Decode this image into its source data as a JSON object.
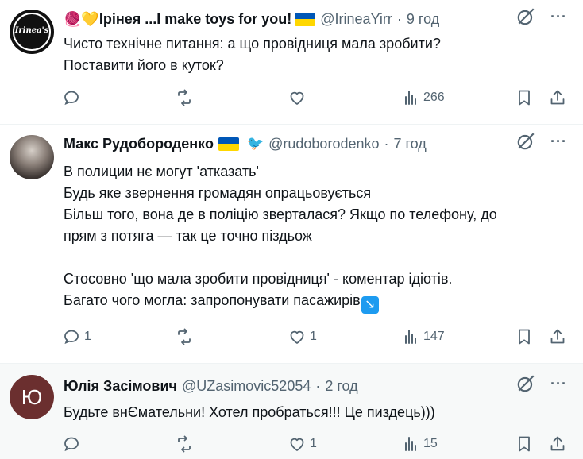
{
  "tweets": [
    {
      "name_prefix": "🧶💛",
      "name": "Ірінея ...I make toys for you!",
      "handle": "@IrineaYirr",
      "time": "9 год",
      "avatar_text": "Irinea's",
      "text": "Чисто технічне питання: а що провідниця мала зробити?\nПоставити його в куток?",
      "replies": "",
      "retweets": "",
      "likes": "",
      "views": "266"
    },
    {
      "name": "Макс Рудобороденко",
      "handle": "@rudoborodenko",
      "time": "7 год",
      "bird_emoji": "🐦",
      "text": "В полиции нє могут 'атказать'\nБудь яке звернення громадян опрацьовується\nБільш того, вона де в поліцію зверталася? Якщо по телефону, до\nпрям з потяга — так це точно піздьож\n\nСтосовно 'що мала зробити провідниця' - коментар ідіотів.\nБагато чого могла: запропонувати пасажирів",
      "arrow_emoji": "↘",
      "replies": "1",
      "retweets": "",
      "likes": "1",
      "views": "147"
    },
    {
      "name": "Юлія Засімович",
      "handle": "@UZasimovic52054",
      "time": "2 год",
      "avatar_text": "Ю",
      "text": "Будьте внЄмательни! Хотел пробраться!!! Це пиздець)))",
      "replies": "",
      "retweets": "",
      "likes": "1",
      "views": "15"
    }
  ],
  "ui": {
    "more": "···",
    "dot": "·"
  },
  "colors": {
    "text": "#0f1419",
    "secondary": "#536471",
    "divider": "#eff3f4",
    "flag_blue": "#0057b7",
    "flag_yellow": "#ffd700"
  }
}
